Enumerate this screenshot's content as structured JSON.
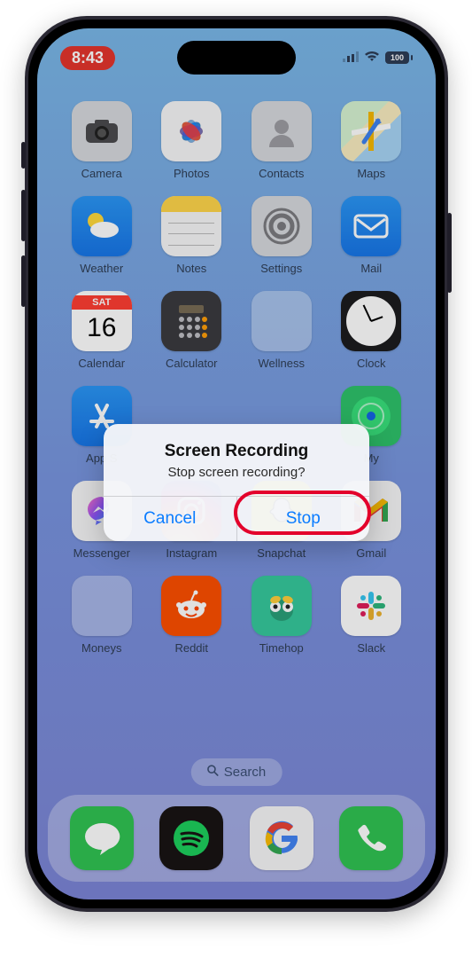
{
  "status": {
    "time": "8:43",
    "battery_text": "100"
  },
  "apps": [
    {
      "label": "Camera"
    },
    {
      "label": "Photos"
    },
    {
      "label": "Contacts"
    },
    {
      "label": "Maps"
    },
    {
      "label": "Weather"
    },
    {
      "label": "Notes"
    },
    {
      "label": "Settings"
    },
    {
      "label": "Mail"
    },
    {
      "label": "Calendar",
      "day_label": "SAT",
      "day_num": "16"
    },
    {
      "label": "Calculator"
    },
    {
      "label": "Wellness"
    },
    {
      "label": "Clock"
    },
    {
      "label": "App S"
    },
    {
      "label": ""
    },
    {
      "label": ""
    },
    {
      "label": "My"
    },
    {
      "label": "Messenger"
    },
    {
      "label": "Instagram"
    },
    {
      "label": "Snapchat"
    },
    {
      "label": "Gmail"
    },
    {
      "label": "Moneys"
    },
    {
      "label": "Reddit"
    },
    {
      "label": "Timehop"
    },
    {
      "label": "Slack"
    }
  ],
  "search": {
    "label": "Search"
  },
  "alert": {
    "title": "Screen Recording",
    "message": "Stop screen recording?",
    "cancel": "Cancel",
    "stop": "Stop"
  },
  "annotation": {
    "highlight": "stop-button"
  }
}
